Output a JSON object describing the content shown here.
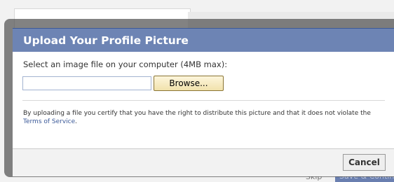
{
  "dialog": {
    "title": "Upload Your Profile Picture",
    "prompt": "Select an image file on your computer (4MB max):",
    "file_input": {
      "value": "",
      "placeholder": ""
    },
    "browse_label": "Browse...",
    "disclaimer_text": "By uploading a file you certify that you have the right to distribute this picture and that it does not violate the ",
    "terms_link": "Terms of Service",
    "disclaimer_end": ".",
    "cancel_label": "Cancel"
  },
  "background": {
    "bottom_link": "Skip",
    "bottom_button": "Save & Continue"
  },
  "colors": {
    "title_bar": "#6d84b4",
    "link": "#3b5998"
  }
}
